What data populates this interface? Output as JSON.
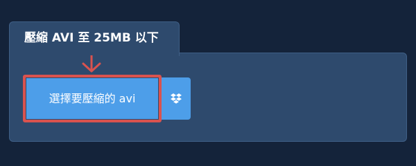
{
  "upload_widget": {
    "tab_title": "壓縮 AVI 至 25MB 以下",
    "select_button_label": "選擇要壓縮的 avi",
    "dropbox_icon": "dropbox-icon"
  },
  "colors": {
    "background": "#14233a",
    "panel": "#2e4a6d",
    "button": "#4d9ee9",
    "highlight": "#d9534f",
    "text": "#ffffff"
  }
}
